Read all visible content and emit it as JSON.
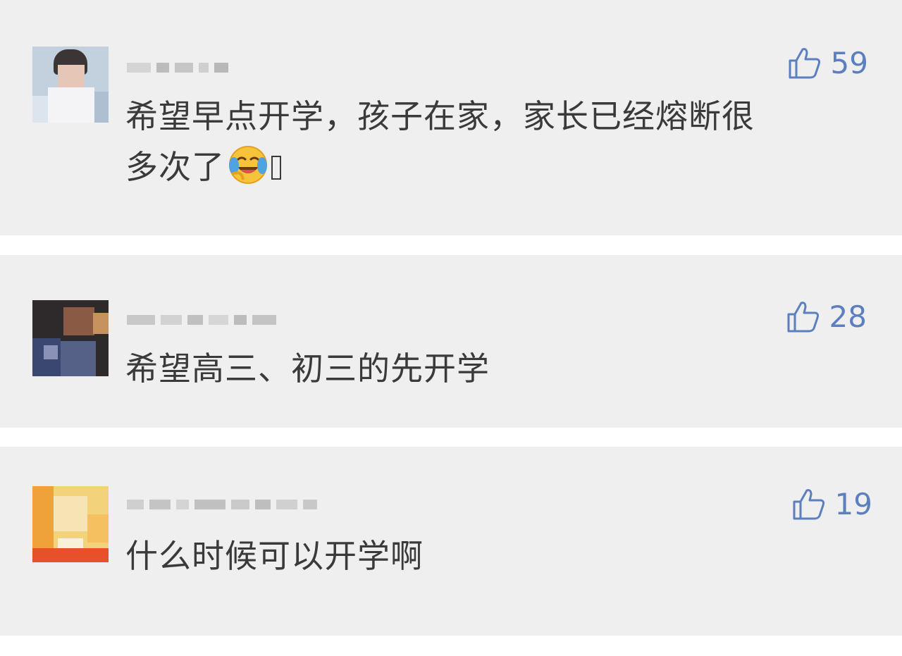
{
  "comments": [
    {
      "text_line1": "希望早点开学，孩子在家，家长已经熔断很",
      "text_line2": "多次了",
      "emoji": "crying-laughing-face",
      "likes": "59"
    },
    {
      "text_line1": "希望高三、初三的先开学",
      "likes": "28"
    },
    {
      "text_line1": "什么时候可以开学啊",
      "likes": "19"
    }
  ],
  "colors": {
    "card_background": "#efefef",
    "separator": "#ffffff",
    "comment_text": "#3a3a3a",
    "like_accent": "#5b7fbf"
  },
  "icons": [
    "thumbs-up-icon",
    "crying-laughing-emoji"
  ]
}
